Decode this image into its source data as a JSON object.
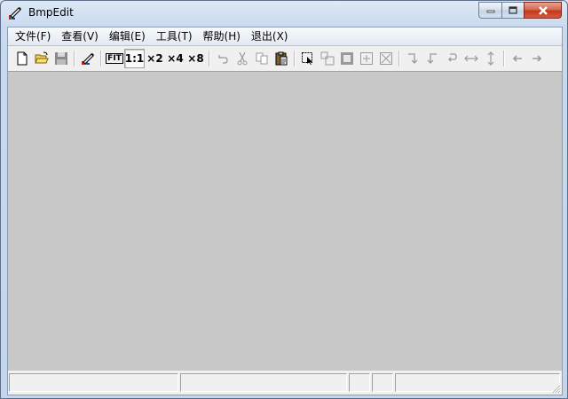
{
  "window": {
    "title": "BmpEdit"
  },
  "menubar": {
    "items": [
      {
        "label": "文件(F)"
      },
      {
        "label": "查看(V)"
      },
      {
        "label": "编辑(E)"
      },
      {
        "label": "工具(T)"
      },
      {
        "label": "帮助(H)"
      },
      {
        "label": "退出(X)"
      }
    ]
  },
  "toolbar": {
    "fit_label": "FIT",
    "zoom_1_label": "1:1",
    "zoom_2_label": "×2",
    "zoom_4_label": "×4",
    "zoom_8_label": "×8",
    "selected_zoom": "1:1"
  },
  "statusbar": {
    "panels": [
      "",
      "",
      "",
      "",
      ""
    ]
  },
  "colors": {
    "canvas_bg": "#c8c8c8",
    "client_bg": "#f0f0f0",
    "close_red": "#c2391c"
  }
}
